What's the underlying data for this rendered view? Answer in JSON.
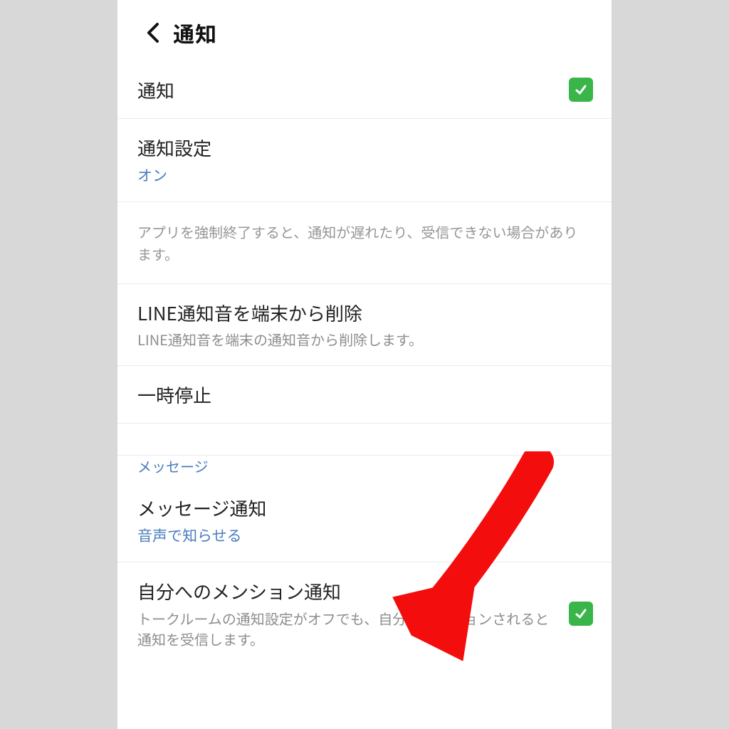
{
  "header": {
    "title": "通知"
  },
  "rows": {
    "notifications": {
      "label": "通知",
      "checked": true
    },
    "notification_settings": {
      "label": "通知設定",
      "value": "オン"
    },
    "force_quit_info": "アプリを強制終了すると、通知が遅れたり、受信できない場合があります。",
    "delete_sound": {
      "label": "LINE通知音を端末から削除",
      "sub": "LINE通知音を端末の通知音から削除します。"
    },
    "pause": {
      "label": "一時停止"
    },
    "section_message": "メッセージ",
    "message_notifications": {
      "label": "メッセージ通知",
      "value": "音声で知らせる"
    },
    "mention": {
      "label": "自分へのメンション通知",
      "sub": "トークルームの通知設定がオフでも、自分がメンションされると通知を受信します。",
      "checked": true
    }
  },
  "colors": {
    "accent_green": "#3ab54a",
    "link_blue": "#4a7dbf",
    "annotation_red": "#f40d0d"
  }
}
